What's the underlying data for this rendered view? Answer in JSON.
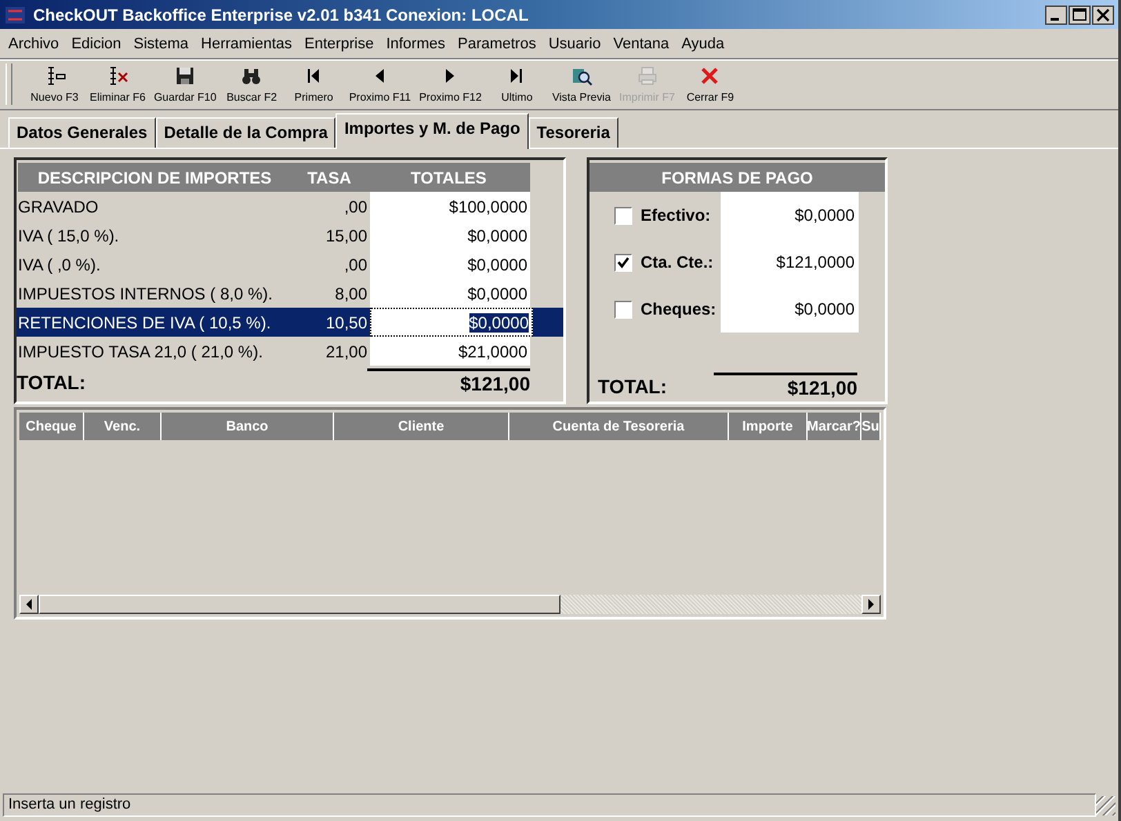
{
  "window": {
    "title": "CheckOUT Backoffice Enterprise v2.01 b341 Conexion: LOCAL"
  },
  "menu": [
    "Archivo",
    "Edicion",
    "Sistema",
    "Herramientas",
    "Enterprise",
    "Informes",
    "Parametros",
    "Usuario",
    "Ventana",
    "Ayuda"
  ],
  "toolbar": [
    {
      "label": "Nuevo F3",
      "kind": "new",
      "disabled": false
    },
    {
      "label": "Eliminar F6",
      "kind": "delete",
      "disabled": false
    },
    {
      "label": "Guardar F10",
      "kind": "save",
      "disabled": false
    },
    {
      "label": "Buscar F2",
      "kind": "search",
      "disabled": false
    },
    {
      "label": "Primero",
      "kind": "first",
      "disabled": false
    },
    {
      "label": "Proximo F11",
      "kind": "prev",
      "disabled": false
    },
    {
      "label": "Proximo F12",
      "kind": "next",
      "disabled": false
    },
    {
      "label": "Ultimo",
      "kind": "last",
      "disabled": false
    },
    {
      "label": "Vista Previa",
      "kind": "preview",
      "disabled": false
    },
    {
      "label": "Imprimir F7",
      "kind": "print",
      "disabled": true
    },
    {
      "label": "Cerrar F9",
      "kind": "close",
      "disabled": false
    }
  ],
  "tabs": [
    {
      "label": "Datos Generales",
      "selected": false
    },
    {
      "label": "Detalle de la Compra",
      "selected": false
    },
    {
      "label": "Importes y M. de Pago",
      "selected": true
    },
    {
      "label": "Tesoreria",
      "selected": false
    }
  ],
  "importes": {
    "columns": [
      "DESCRIPCION DE IMPORTES",
      "TASA",
      "TOTALES"
    ],
    "rows": [
      {
        "descripcion": "GRAVADO",
        "tasa": ",00",
        "total": "$100,0000",
        "selected": false
      },
      {
        "descripcion": "IVA  ( 15,0 %).",
        "tasa": "15,00",
        "total": "$0,0000",
        "selected": false
      },
      {
        "descripcion": "IVA  ( ,0 %).",
        "tasa": ",00",
        "total": "$0,0000",
        "selected": false
      },
      {
        "descripcion": "IMPUESTOS INTERNOS  ( 8,0 %).",
        "tasa": "8,00",
        "total": "$0,0000",
        "selected": false
      },
      {
        "descripcion": "RETENCIONES DE IVA  ( 10,5 %).",
        "tasa": "10,50",
        "total": "$0,0000",
        "selected": true
      },
      {
        "descripcion": "IMPUESTO TASA 21,0  ( 21,0 %).",
        "tasa": "21,00",
        "total": "$21,0000",
        "selected": false
      }
    ],
    "total_label": "TOTAL:",
    "total": "$121,00"
  },
  "formas_de_pago": {
    "title": "FORMAS DE PAGO",
    "items": [
      {
        "label": "Efectivo:",
        "checked": false,
        "value": "$0,0000"
      },
      {
        "label": "Cta. Cte.:",
        "checked": true,
        "value": "$121,0000"
      },
      {
        "label": "Cheques:",
        "checked": false,
        "value": "$0,0000"
      }
    ],
    "total_label": "TOTAL:",
    "total": "$121,00"
  },
  "cheques_table": {
    "columns": [
      "Cheque",
      "Venc.",
      "Banco",
      "Cliente",
      "Cuenta de Tesoreria",
      "Importe",
      "Marcar?",
      "Su"
    ]
  },
  "status_bar": "Inserta un registro"
}
